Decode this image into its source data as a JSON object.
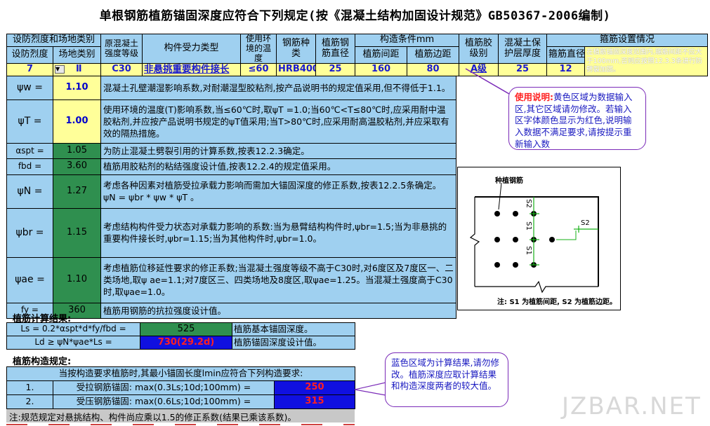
{
  "title": "单根钢筋植筋锚固深度应符合下列规定(按《混凝土结构加固设计规范》GB50367-2006编制)",
  "header": {
    "col_seismic_group": "设防烈度和场地类别",
    "col_seismic": "设防烈度",
    "col_site": "场地类别",
    "col_concrete": "原混凝土强度等级",
    "col_member": "构件受力类型",
    "col_env": "使用环境的温度",
    "col_rebar_type": "钢筋种类",
    "col_rebar_dia": "植筋钢筋直径",
    "col_cond_group": "构造条件mm",
    "col_spacing": "植筋间距",
    "col_edge": "植筋边距",
    "col_glue": "植筋胶级别",
    "col_cover": "混凝土保护层厚度",
    "col_stirrup_group": "箍筋设置情况",
    "col_stirrup_dia": "箍筋直径",
    "col_stirrup_note": "在植筋锚固深度范围内,箍筋间距不应大于100mm,否则应按照12.3.3条进行防劈裂加固。"
  },
  "inputs": {
    "seismic": "7",
    "site": "Ⅱ",
    "concrete": "C30",
    "member": "非悬挑重要构件接长",
    "env": "≤60",
    "rebar_type": "HRB400",
    "rebar_dia": "25",
    "spacing": "160",
    "edge": "80",
    "glue": "A级",
    "cover": "25",
    "stirrup_dia": "12"
  },
  "params": [
    {
      "sym": "ψw =",
      "val": "1.10",
      "desc": "混凝土孔壁潮湿影响系数,对耐潮湿型胶粘剂,按产品说明书的规定值采用,但不得低于1.1。"
    },
    {
      "sym": "ψT =",
      "val": "1.00",
      "desc": "使用环境的温度(T)影响系数,当≤60℃时,取ψT =1.0;当60℃<T≤80℃时,应采用耐中温胶粘剂,并应按产品说明书规定的ψT值采用;当T>80℃时,应采用耐高温胶粘剂,并应采取有效的隔热措施。"
    },
    {
      "sym": "αspt =",
      "val": "1.05",
      "desc": "为防止混凝土劈裂引用的计算系数,按表12.2.3确定。"
    },
    {
      "sym": "fbd =",
      "val": "3.60",
      "desc": "植筋用胶粘剂的粘结强度设计值,按表12.2.4的规定值采用。"
    },
    {
      "sym": "ψN =",
      "val": "1.27",
      "desc": "考虑各种因素对植筋受拉承载力影响而需加大锚固深度的修正系数,按表12.2.5条确定。      ψN = ψbr * ψw * ψT 。"
    },
    {
      "sym": "ψbr =",
      "val": "1.15",
      "desc": "考虑结构构件受力状态对承载力影响的系数:当为悬臂结构构件时,ψbr=1.5;当为非悬挑的重要构件接长时,ψbr=1.15;当为其他构件时,ψbr=1.0。"
    },
    {
      "sym": "ψae =",
      "val": "1.10",
      "desc": "考虑植筋位移延性要求的修正系数;当混凝土强度等级不高于C30时,对6度区及7度区一、二类场地,取ψ ae=1.1;对7度区三、四类场地及8度区,取ψae=1.25。当混凝土强度高于C30时,取ψae=1.0。"
    },
    {
      "sym": "fy =",
      "val": "360",
      "desc": "植筋用钢筋的抗拉强度设计值。"
    }
  ],
  "calc": {
    "title": "植筋计算结果:",
    "row1_formula": "Ls = 0.2*αspt*d*fy/fbd =",
    "row1_val": "525",
    "row1_desc": "植筋基本锚固深度。",
    "row2_formula": "Ld ≥ ψN*ψae*Ls =",
    "row2_val": "730(29.2d)",
    "row2_desc": "植筋锚固深度设计值。"
  },
  "constr": {
    "title": "植筋构造规定:",
    "intro": "当按构造要求植筋时,其最小锚固长度lmin应符合下列构造要求:",
    "row1_no": "1.",
    "row1_text": "受拉钢筋锚固: max(0.3Ls;10d;100mm) =",
    "row1_val": "250",
    "row2_no": "2.",
    "row2_text": "受压钢筋锚固: max(0.6Ls;10d;100mm) =",
    "row2_val": "315",
    "note": "注:规范规定对悬挑结构、构件尚应乘以1.5的修正系数(结果已乘该系数)。"
  },
  "callout1": {
    "label": "使用说明:",
    "text": "黄色区域为数据输入区,其它区域请勿修改。若输入区字体颜色显示为红色,说明输入数据不满足要求,请按提示重新输入数"
  },
  "callout2": {
    "text": "蓝色区域为计算结果,请勿修改。植筋深度应取计算结果和构造深度两者的较大值。"
  },
  "figure": {
    "label_top": "种植钢筋",
    "s1": "S1",
    "s2": "S2",
    "caption": "注: S1 为植筋间距, S2 为植筋边距。"
  },
  "watermark": "JZBAR.NET"
}
